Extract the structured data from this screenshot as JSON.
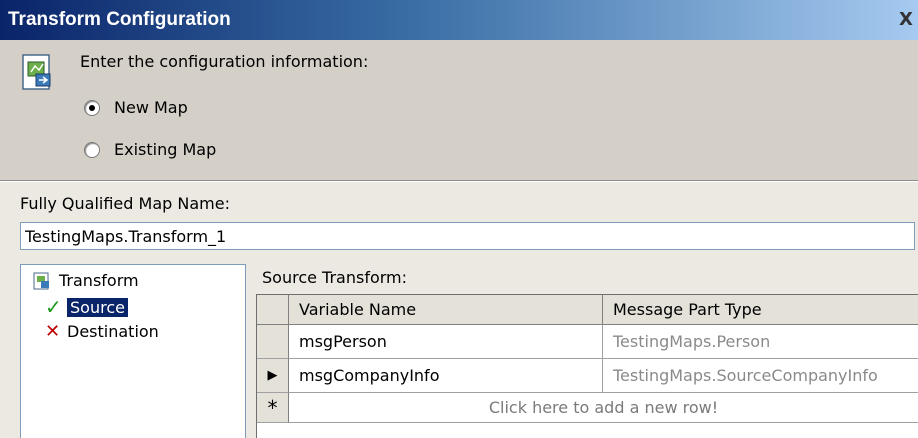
{
  "window": {
    "title": "Transform Configuration",
    "close_glyph": "X"
  },
  "config": {
    "prompt": "Enter the configuration information:",
    "icon": "map-document-icon",
    "options": [
      {
        "label": "New Map",
        "checked": true
      },
      {
        "label": "Existing Map",
        "checked": false
      }
    ]
  },
  "map_name": {
    "label": "Fully Qualified Map Name:",
    "value": "TestingMaps.Transform_1"
  },
  "tree": {
    "root": "Transform",
    "children": [
      {
        "label": "Source",
        "status": "check",
        "glyph": "✓",
        "selected": true
      },
      {
        "label": "Destination",
        "status": "cross",
        "glyph": "✕",
        "selected": false
      }
    ]
  },
  "source_transform": {
    "label": "Source Transform:",
    "columns": [
      "Variable Name",
      "Message Part Type"
    ],
    "rows": [
      {
        "marker": "",
        "variable": "msgPerson",
        "type": "TestingMaps.Person"
      },
      {
        "marker": "▶",
        "variable": "msgCompanyInfo",
        "type": "TestingMaps.SourceCompanyInfo"
      }
    ],
    "new_row_marker": "*",
    "new_row_text": "Click here to add a new row!"
  },
  "colors": {
    "title_bar_start": "#0a246a",
    "title_bar_end": "#a6caf0",
    "check_green": "#1a9a1a",
    "cross_red": "#c00000",
    "selection": "#0a246a"
  }
}
